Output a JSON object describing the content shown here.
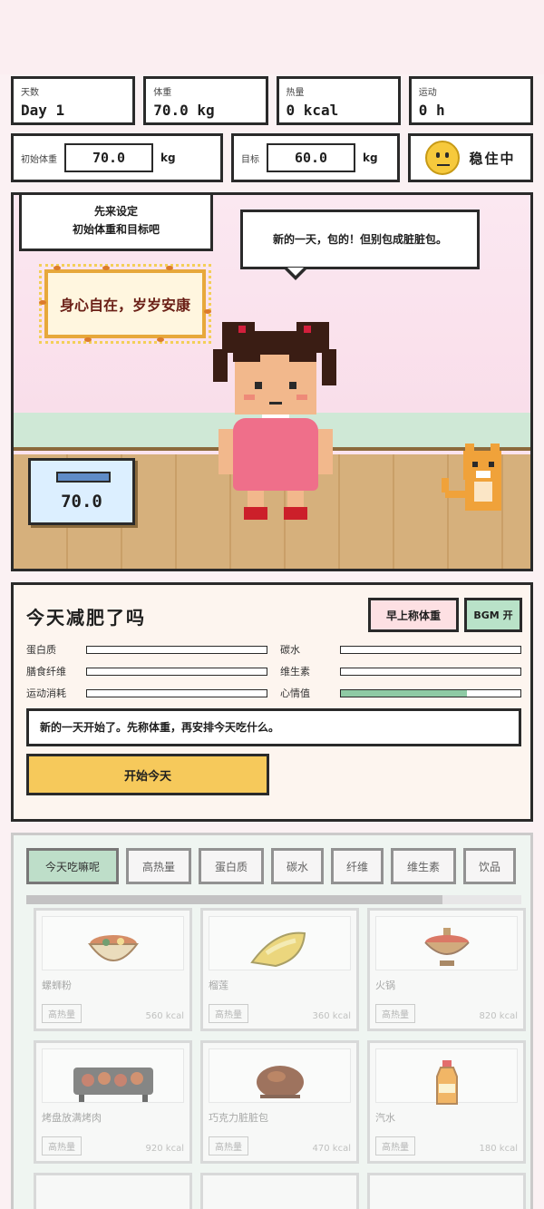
{
  "stats": [
    {
      "label": "天数",
      "value": "Day 1"
    },
    {
      "label": "体重",
      "value": "70.0 kg"
    },
    {
      "label": "热量",
      "value": "0 kcal"
    },
    {
      "label": "运动",
      "value": "0 h"
    }
  ],
  "config": {
    "start_label": "初始体重",
    "start_value": "70.0",
    "target_label": "目标",
    "target_value": "60.0",
    "unit": "kg",
    "mood_text": "稳住中"
  },
  "scene": {
    "hint_line1": "先来设定",
    "hint_line2": "初始体重和目标吧",
    "speech": "新的一天，包的！但别包成脏脏包。",
    "banner": "身心自在，岁岁安康",
    "scale_value": "70.0"
  },
  "panel": {
    "title": "今天减肥了吗",
    "weigh_button": "早上称体重",
    "bgm_button": "BGM 开",
    "nutrients_left": [
      {
        "label": "蛋白质",
        "fill": 0
      },
      {
        "label": "膳食纤维",
        "fill": 0
      },
      {
        "label": "运动消耗",
        "fill": 0
      }
    ],
    "nutrients_right": [
      {
        "label": "碳水",
        "fill": 0
      },
      {
        "label": "维生素",
        "fill": 0
      },
      {
        "label": "心情值",
        "fill": 0.7
      }
    ],
    "message": "新的一天开始了。先称体重，再安排今天吃什么。",
    "start_button": "开始今天"
  },
  "colors": {
    "mood_fill": "#8ecaa4",
    "start_button": "#f6c95b",
    "weigh_button": "#fde0e3",
    "bgm_button": "#b9e2c8"
  },
  "food": {
    "tabs": [
      "今天吃嘛呢",
      "高热量",
      "蛋白质",
      "碳水",
      "纤维",
      "维生素",
      "饮品"
    ],
    "scroll_progress": 0.84,
    "items": [
      {
        "name": "螺蛳粉",
        "tag": "高热量",
        "kcal": "560 kcal",
        "icon": "noodle-bowl-icon"
      },
      {
        "name": "榴莲",
        "tag": "高热量",
        "kcal": "360 kcal",
        "icon": "durian-icon"
      },
      {
        "name": "火锅",
        "tag": "高热量",
        "kcal": "820 kcal",
        "icon": "hotpot-icon"
      },
      {
        "name": "烤盘放满烤肉",
        "tag": "高热量",
        "kcal": "920 kcal",
        "icon": "bbq-grill-icon"
      },
      {
        "name": "巧克力脏脏包",
        "tag": "高热量",
        "kcal": "470 kcal",
        "icon": "chocolate-bun-icon"
      },
      {
        "name": "汽水",
        "tag": "高热量",
        "kcal": "180 kcal",
        "icon": "soda-bottle-icon"
      }
    ]
  }
}
